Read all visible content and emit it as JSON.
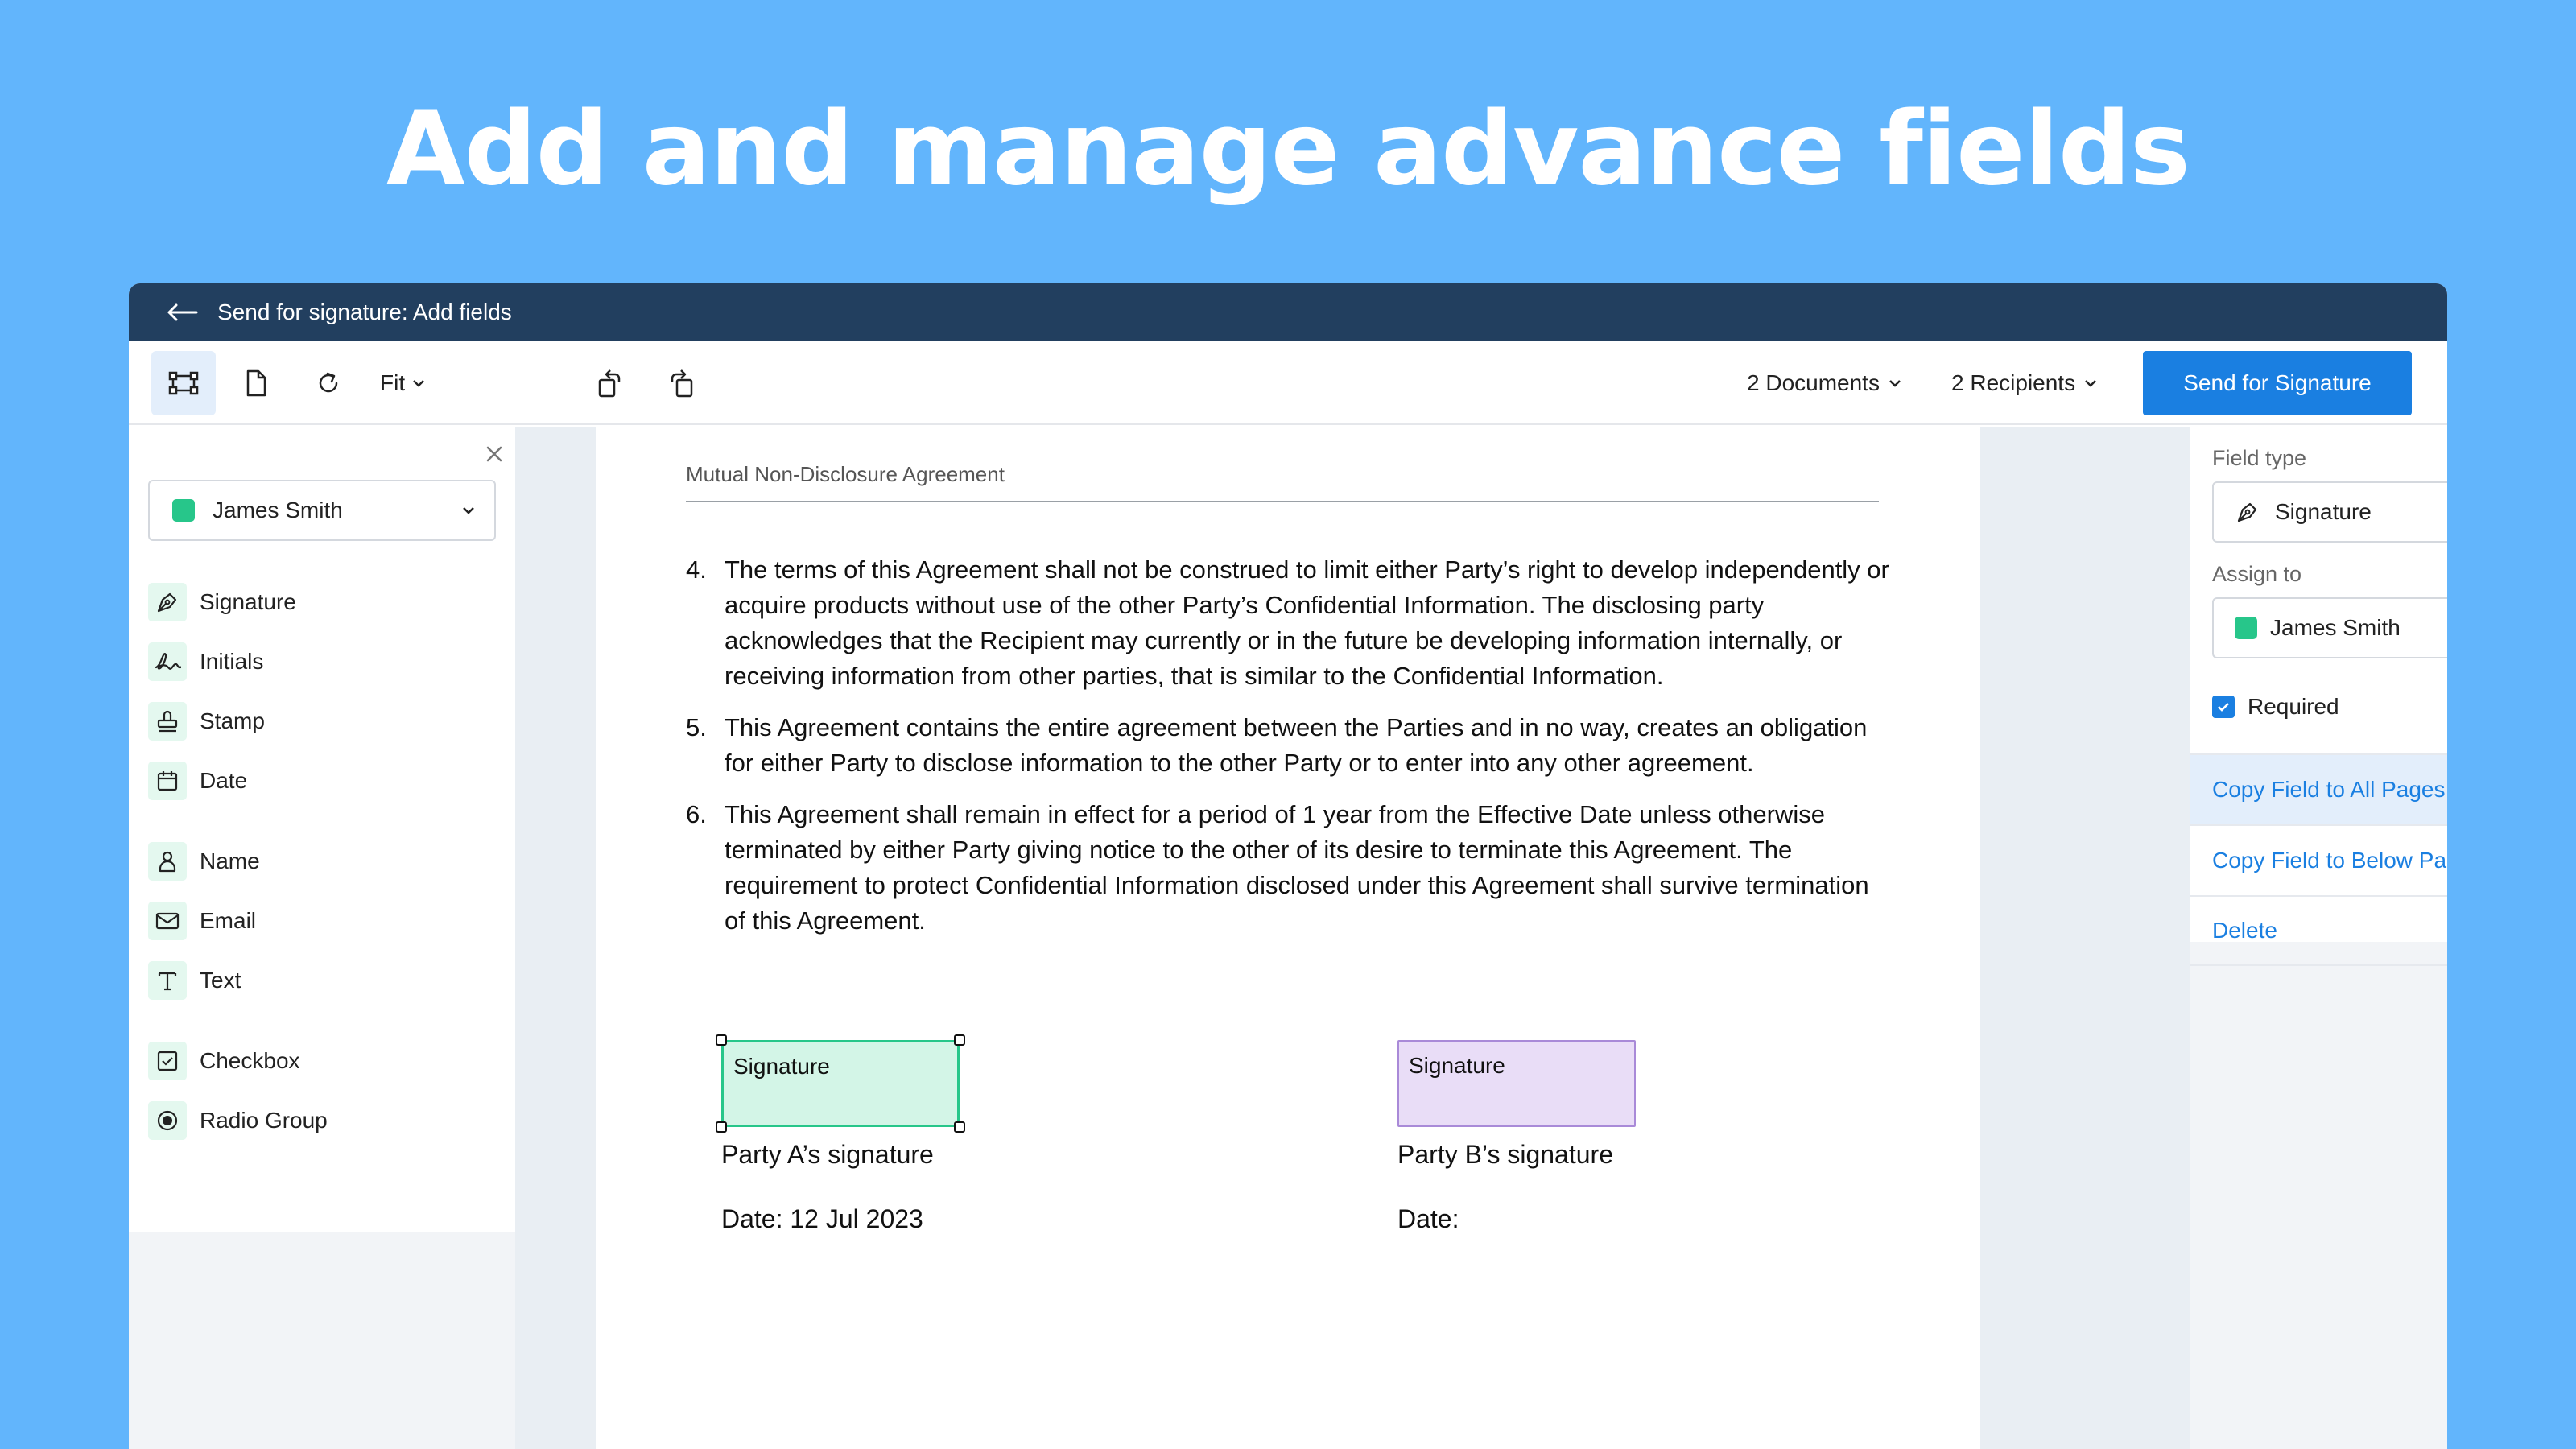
{
  "hero": {
    "title": "Add and manage advance fields"
  },
  "titlebar": {
    "title": "Send for signature: Add fields"
  },
  "toolbar": {
    "fit_label": "Fit",
    "documents_label": "2 Documents",
    "recipients_label": "2 Recipients",
    "send_label": "Send for Signature"
  },
  "left_panel": {
    "recipient": {
      "name": "James Smith",
      "color": "#27C68A"
    },
    "fields": [
      {
        "label": "Signature",
        "icon": "pen-nib-icon"
      },
      {
        "label": "Initials",
        "icon": "initials-icon"
      },
      {
        "label": "Stamp",
        "icon": "stamp-icon"
      },
      {
        "label": "Date",
        "icon": "calendar-icon"
      },
      {
        "label": "Name",
        "icon": "person-icon"
      },
      {
        "label": "Email",
        "icon": "envelope-icon"
      },
      {
        "label": "Text",
        "icon": "text-icon"
      },
      {
        "label": "Checkbox",
        "icon": "checkbox-icon"
      },
      {
        "label": "Radio Group",
        "icon": "radio-icon"
      }
    ]
  },
  "document": {
    "header": "Mutual Non-Disclosure Agreement",
    "clauses": [
      {
        "num": "4.",
        "text": "The terms of this Agreement shall not be construed to limit either Party’s right to develop independently or acquire products without use of the other Party’s Confidential Information. The disclosing party acknowledges that the Recipient may currently or in the future be developing information internally, or receiving information from other parties, that is similar to the Confidential Information."
      },
      {
        "num": "5.",
        "text": "This Agreement contains the entire agreement between the Parties and in no way, creates an obligation for either Party to disclose information to the other Party or to enter into any other agreement."
      },
      {
        "num": "6.",
        "text": "This Agreement shall remain in effect for a period of 1 year from the Effective Date unless otherwise terminated by either Party giving notice to the other of its desire to terminate this Agreement. The requirement to protect Confidential Information disclosed under this Agreement shall survive termination of this Agreement."
      }
    ],
    "party_a": {
      "field_label": "Signature",
      "caption": "Party A’s signature",
      "date": "Date: 12 Jul 2023",
      "color": "#27C68A"
    },
    "party_b": {
      "field_label": "Signature",
      "caption": "Party B’s signature",
      "date": "Date:",
      "color": "#A98AD8"
    }
  },
  "right_panel": {
    "field_type_label": "Field type",
    "field_type_value": "Signature",
    "assign_label": "Assign to",
    "assign_value": "James Smith",
    "required_label": "Required",
    "required_checked": true,
    "actions": [
      "Copy Field to All Pages",
      "Copy Field to Below Pages",
      "Delete"
    ]
  },
  "colors": {
    "background": "#62B5FC",
    "titlebar": "#223F5F",
    "accent": "#1A7FE1"
  }
}
